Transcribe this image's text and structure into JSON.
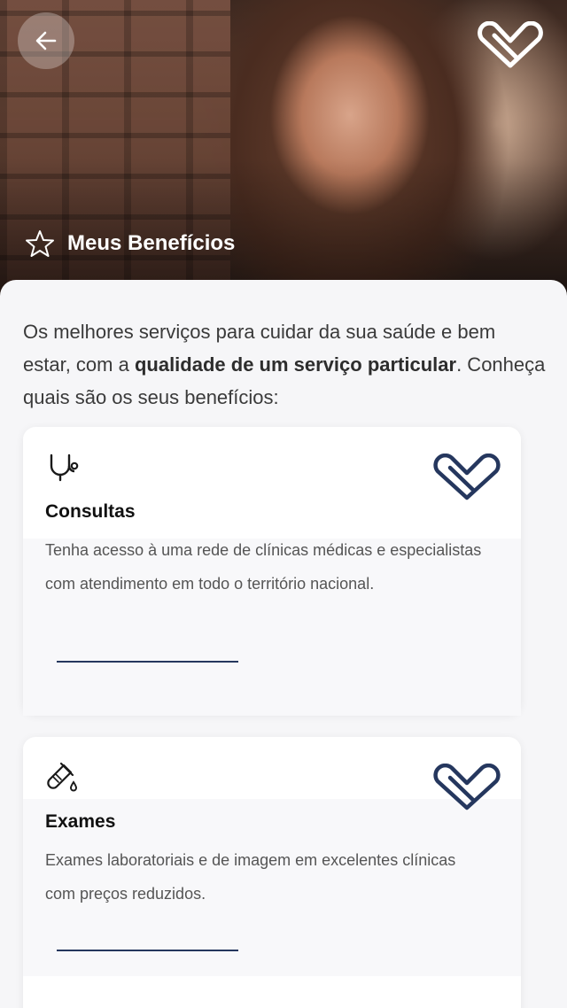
{
  "header": {
    "title": "Meus Benefícios"
  },
  "intro": {
    "part1": "Os melhores serviços para cuidar da sua saúde e bem estar, com a ",
    "bold": "qualidade de um serviço particular",
    "part2": ". Conheça quais são os seus benefícios:"
  },
  "cards": [
    {
      "title": "Consultas",
      "description": "Tenha acesso à uma rede de clínicas médicas e especialistas com atendimento em todo o território nacional.",
      "icon": "stethoscope-icon"
    },
    {
      "title": "Exames",
      "description": "Exames laboratoriais e de imagem em excelentes clínicas com preços  reduzidos.",
      "icon": "test-tube-icon"
    }
  ],
  "colors": {
    "brand_navy": "#25375e",
    "text_dark": "#111111",
    "text_body": "#3a3a3a"
  }
}
